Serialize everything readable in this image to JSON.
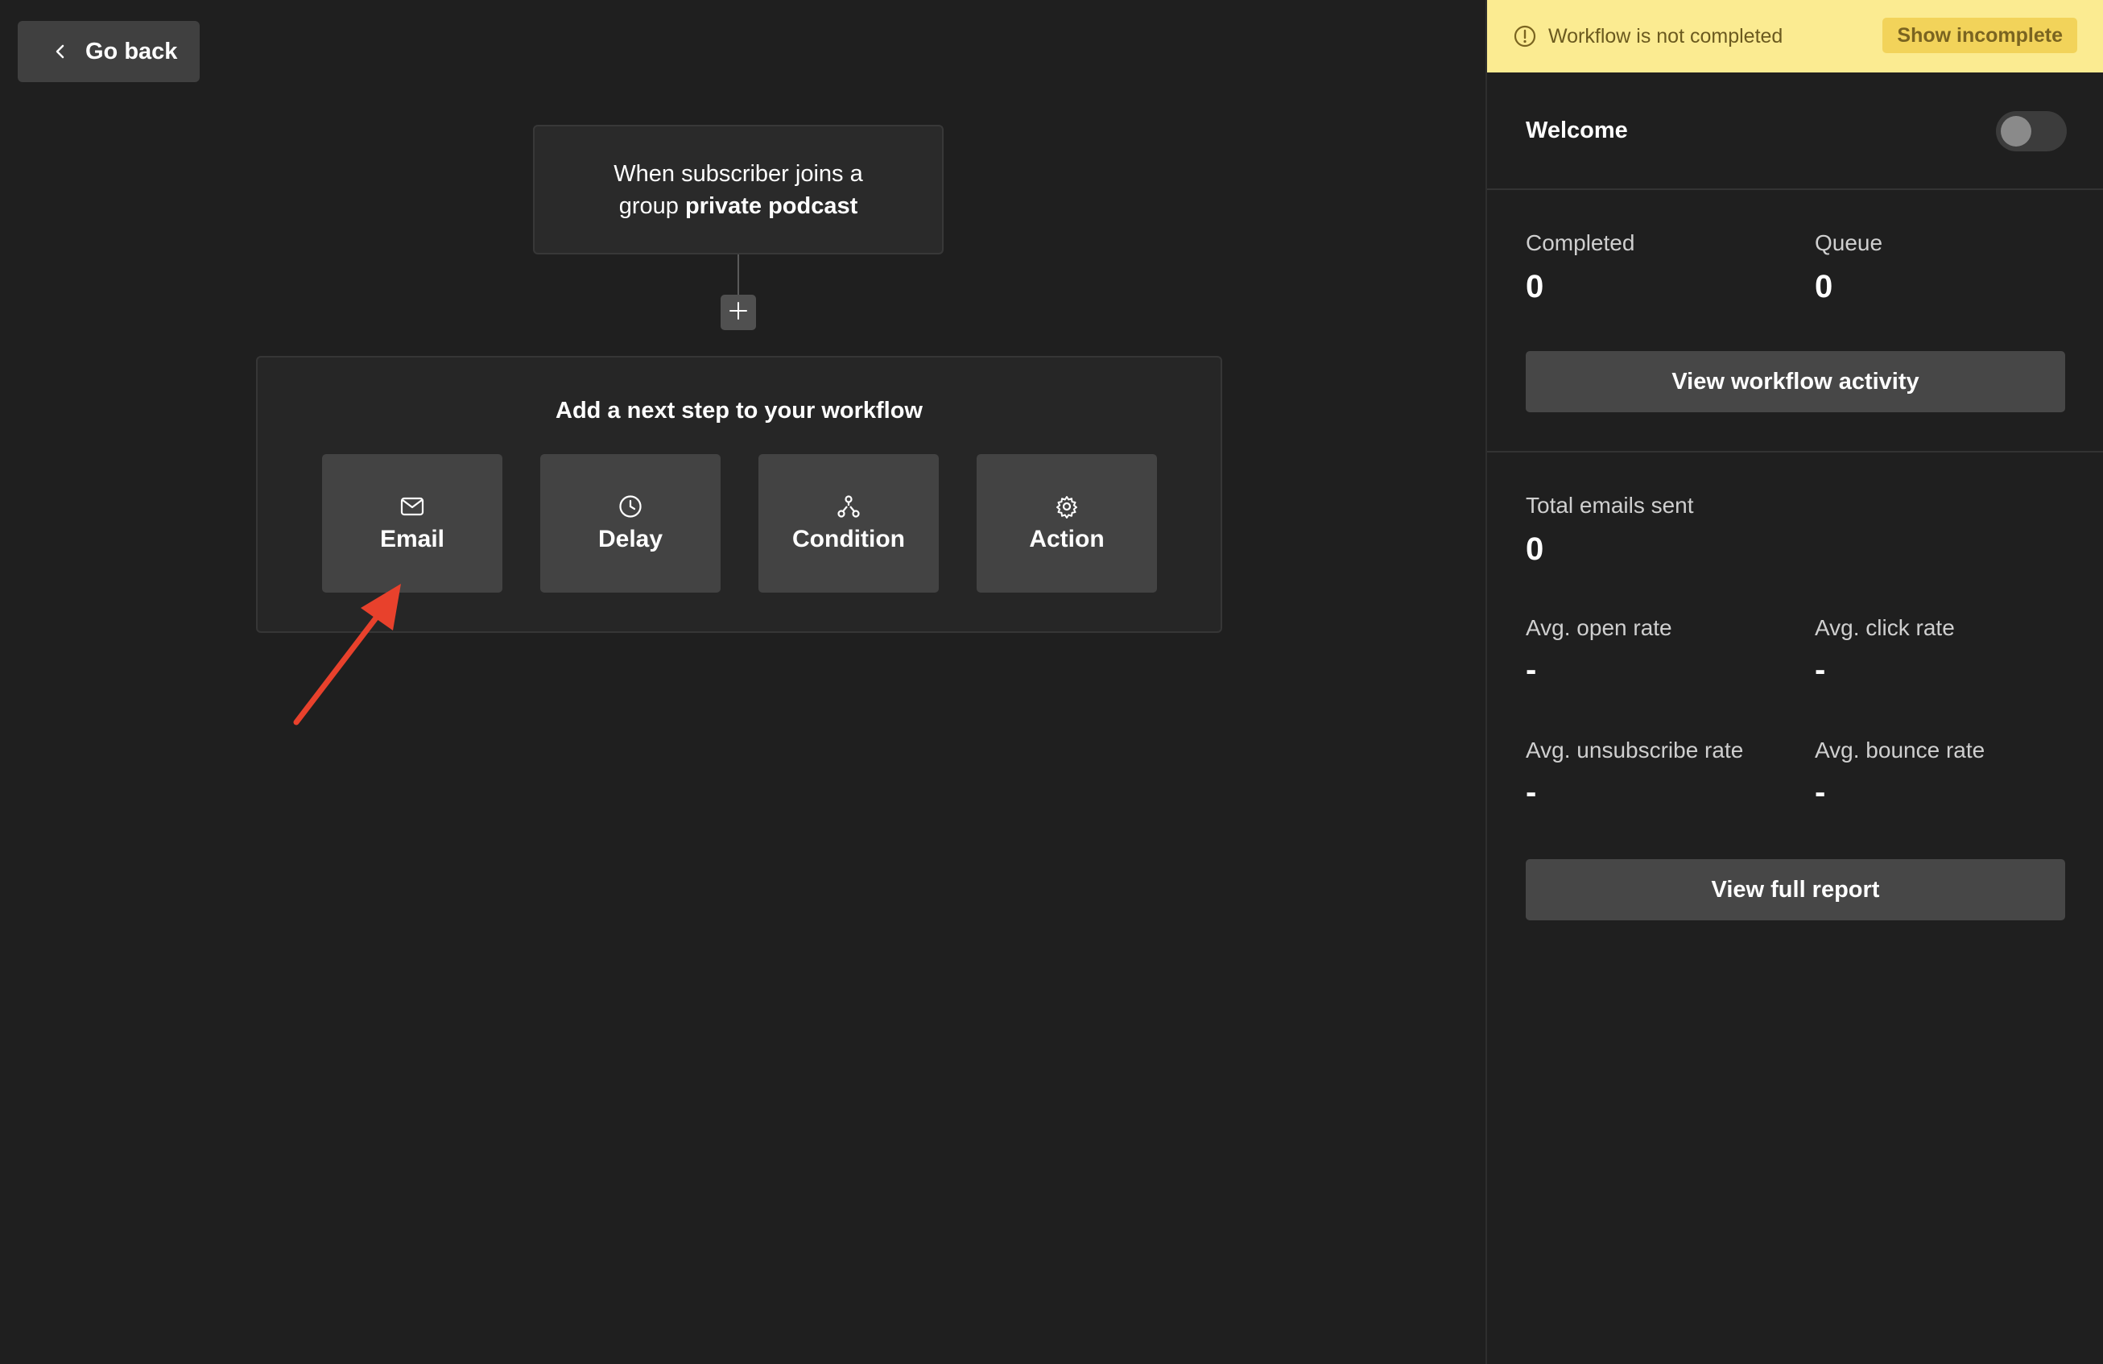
{
  "nav": {
    "go_back_label": "Go back"
  },
  "trigger": {
    "text_prefix": "When subscriber joins a group",
    "group_name": "private podcast"
  },
  "step_panel": {
    "title": "Add a next step to your workflow",
    "options": [
      {
        "label": "Email",
        "icon": "mail-icon"
      },
      {
        "label": "Delay",
        "icon": "clock-icon"
      },
      {
        "label": "Condition",
        "icon": "branch-icon"
      },
      {
        "label": "Action",
        "icon": "gear-icon"
      }
    ]
  },
  "sidebar": {
    "banner": {
      "text": "Workflow is not completed",
      "button_label": "Show incomplete",
      "bg_color": "#fbeb91"
    },
    "workflow_name": "Welcome",
    "toggle_on": false,
    "completed": {
      "label": "Completed",
      "value": "0"
    },
    "queue": {
      "label": "Queue",
      "value": "0"
    },
    "view_activity_label": "View workflow activity",
    "total_emails": {
      "label": "Total emails sent",
      "value": "0"
    },
    "open_rate": {
      "label": "Avg. open rate",
      "value": "-"
    },
    "click_rate": {
      "label": "Avg. click rate",
      "value": "-"
    },
    "unsubscribe_rate": {
      "label": "Avg. unsubscribe rate",
      "value": "-"
    },
    "bounce_rate": {
      "label": "Avg. bounce rate",
      "value": "-"
    },
    "view_report_label": "View full report"
  },
  "colors": {
    "background": "#1f1f1f",
    "button": "#474747",
    "annotation_arrow": "#e8412c"
  }
}
